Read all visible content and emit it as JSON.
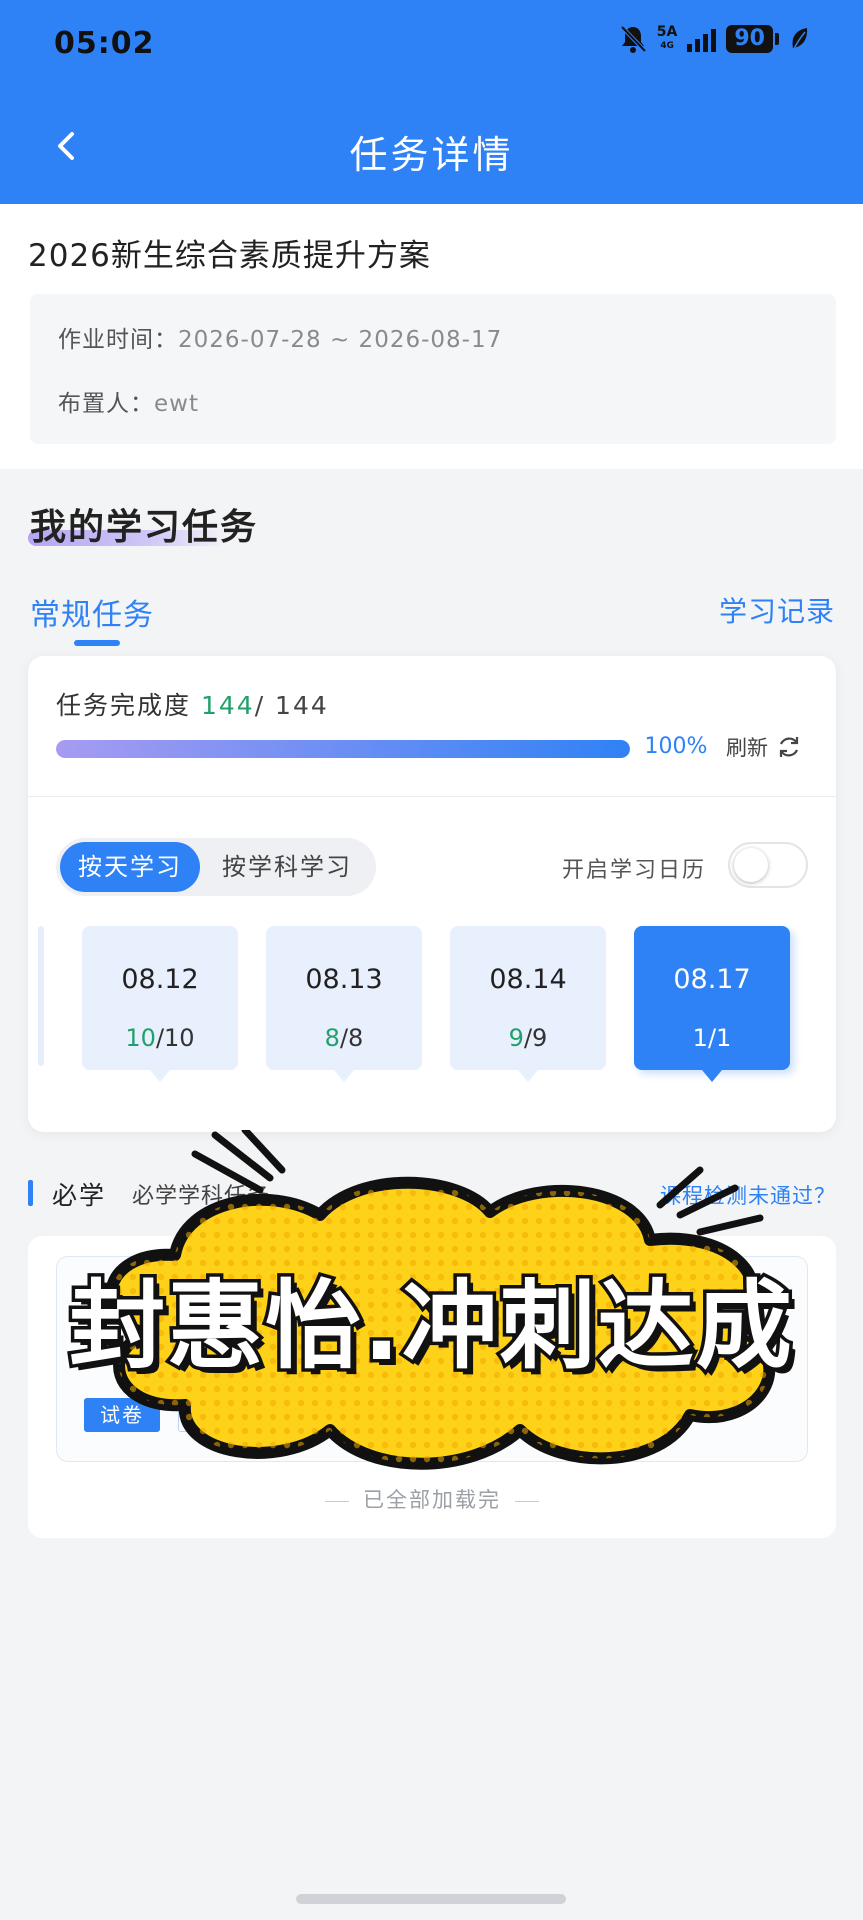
{
  "status_bar": {
    "time": "05:02",
    "network": "5A",
    "network_sub": "4G",
    "battery": "90"
  },
  "header": {
    "title": "任务详情"
  },
  "plan": {
    "title": "2026新生综合素质提升方案",
    "time_label": "作业时间：",
    "time_value": "2026-07-28 ~ 2026-08-17",
    "assigner_label": "布置人：",
    "assigner_value": "ewt"
  },
  "section": {
    "title": "我的学习任务"
  },
  "tabs": {
    "regular": "常规任务",
    "record": "学习记录"
  },
  "completion": {
    "label": "任务完成度",
    "done": "144",
    "total": "/ 144",
    "percent": "100%",
    "fraction": 1.0,
    "refresh": "刷新"
  },
  "mode": {
    "by_day": "按天学习",
    "by_subject": "按学科学习",
    "calendar_label": "开启学习日历",
    "calendar_on": false
  },
  "days": [
    {
      "date": "08.12",
      "done": "10",
      "total": "/10"
    },
    {
      "date": "08.13",
      "done": "8",
      "total": "/8"
    },
    {
      "date": "08.14",
      "done": "9",
      "total": "/9"
    },
    {
      "date": "08.17",
      "done": "1",
      "total": "/1"
    }
  ],
  "required": {
    "title": "必学",
    "subtitle": "必学学科任务",
    "link": "课程检测未通过？"
  },
  "item": {
    "tag": "试卷"
  },
  "list_end": "已全部加载完",
  "overlay": {
    "caption": "封惠怡.冲刺达成"
  },
  "colors": {
    "primary": "#2f82f5",
    "success": "#22a06b",
    "overlay_yellow": "#ffd21a"
  }
}
